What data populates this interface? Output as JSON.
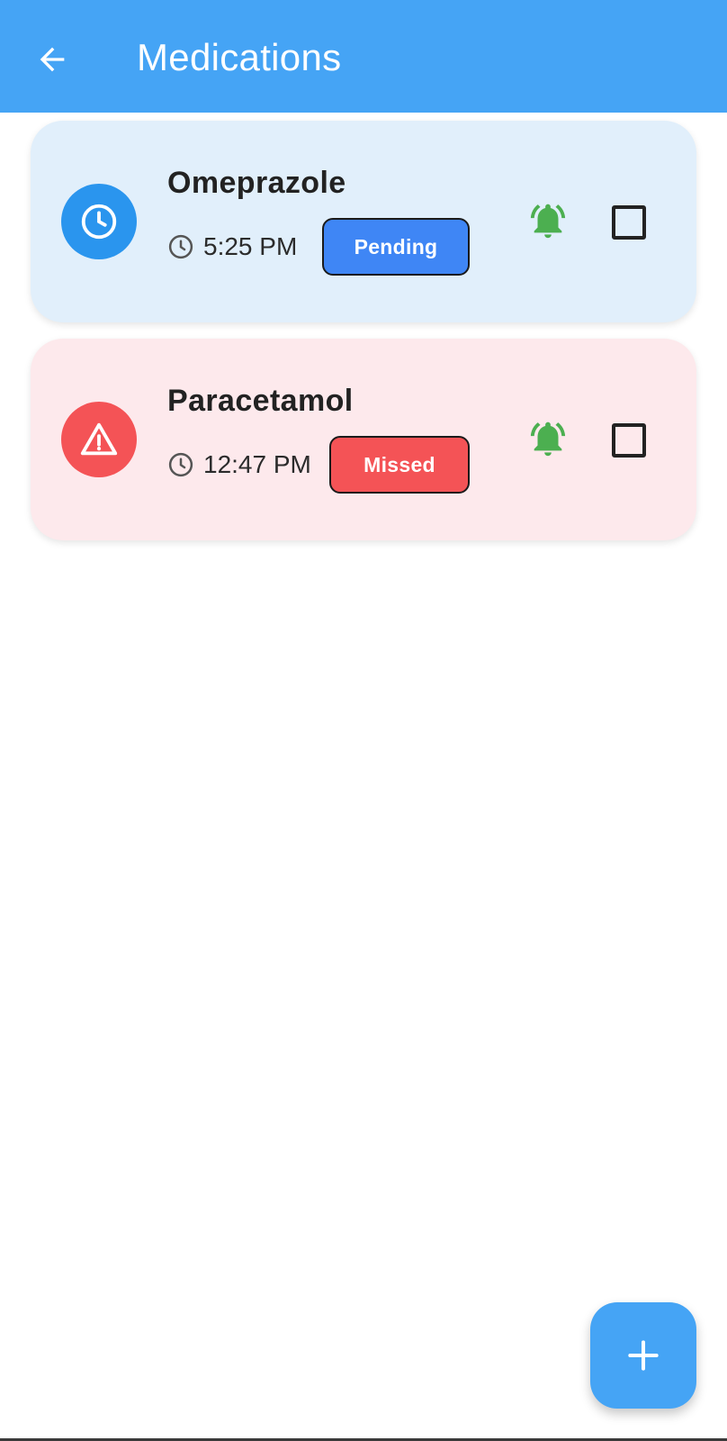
{
  "appbar": {
    "title": "Medications",
    "back_icon": "arrow-left-icon",
    "color": "#45a4f5"
  },
  "medications": [
    {
      "name": "Omeprazole",
      "time": "5:25 PM",
      "status": "Pending",
      "status_icon": "clock-icon",
      "status_color": "#3f86f5",
      "card_color": "#e1effb",
      "alarm_icon": "alarm-bell-icon",
      "taken": false
    },
    {
      "name": "Paracetamol",
      "time": "12:47 PM",
      "status": "Missed",
      "status_icon": "warning-icon",
      "status_color": "#f45356",
      "card_color": "#fde9ec",
      "alarm_icon": "alarm-bell-icon",
      "taken": false
    }
  ],
  "fab": {
    "icon": "plus-icon"
  }
}
